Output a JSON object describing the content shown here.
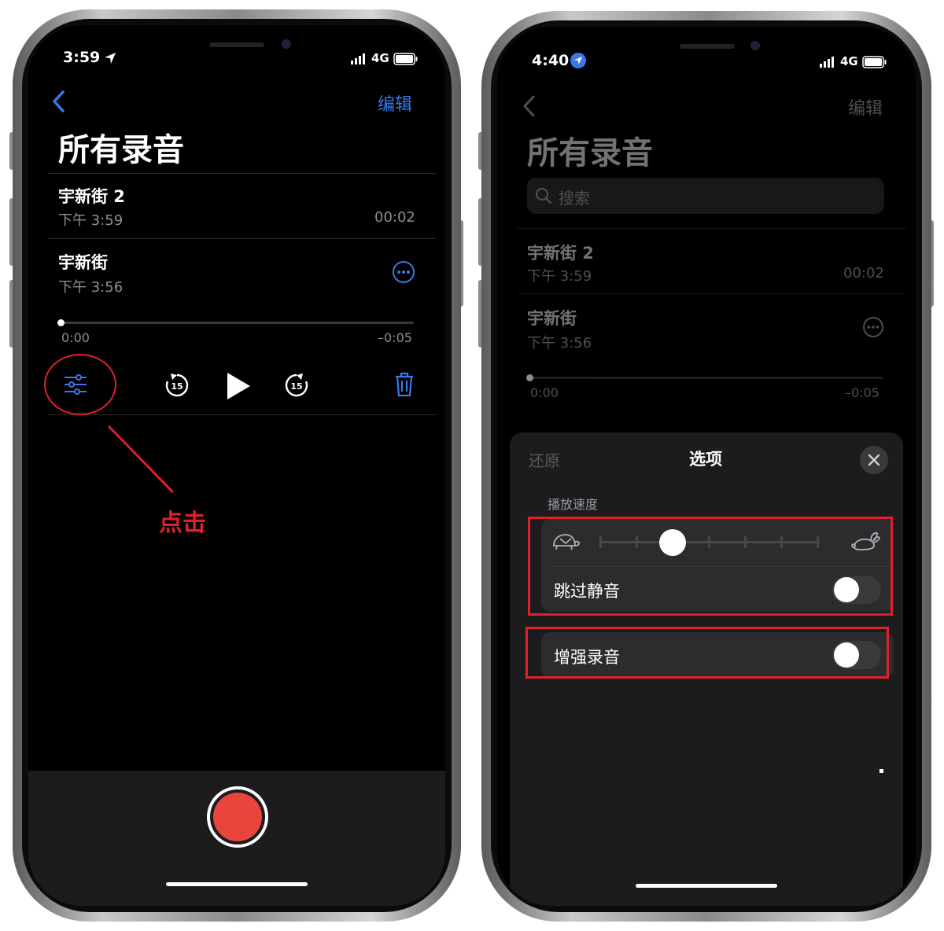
{
  "left_phone": {
    "status": {
      "time": "3:59",
      "network": "4G"
    },
    "nav": {
      "edit_label": "编辑"
    },
    "title": "所有录音",
    "recordings": [
      {
        "name": "宇新街 2",
        "time": "下午 3:59",
        "duration": "00:02"
      },
      {
        "name": "宇新街",
        "time": "下午 3:56"
      }
    ],
    "player": {
      "elapsed": "0:00",
      "remaining": "–0:05",
      "skip_back": "15",
      "skip_forward": "15",
      "progress": 0
    },
    "annotation": {
      "label": "点击"
    }
  },
  "right_phone": {
    "status": {
      "time": "4:40",
      "network": "4G"
    },
    "nav": {
      "edit_label": "编辑"
    },
    "title": "所有录音",
    "search": {
      "placeholder": "搜索"
    },
    "recordings": [
      {
        "name": "宇新街 2",
        "time": "下午 3:59",
        "duration": "00:02"
      },
      {
        "name": "宇新街",
        "time": "下午 3:56"
      }
    ],
    "player": {
      "elapsed": "0:00",
      "remaining": "–0:05",
      "progress": 0
    },
    "options_sheet": {
      "reset_label": "还原",
      "title": "选项",
      "speed_section_label": "播放速度",
      "speed_level": 0.3,
      "skip_silence_label": "跳过静音",
      "skip_silence_on": false,
      "enhance_label": "增强录音",
      "enhance_on": false
    }
  },
  "colors": {
    "accent": "#3a78e8",
    "record": "#e8453c",
    "annotation": "#e0202a",
    "sheet": "#1c1c1e"
  }
}
